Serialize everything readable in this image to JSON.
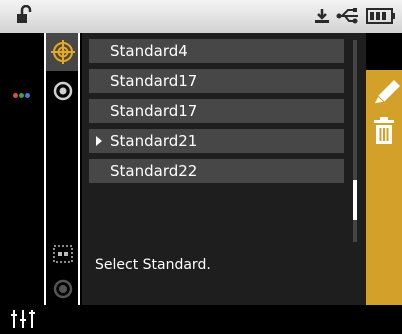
{
  "status_bar": {
    "icons": [
      "lock-open-icon",
      "download-icon",
      "usb-icon",
      "battery-icon"
    ],
    "colors": {
      "bg_top": "#f4f4f4",
      "bg_bottom": "#d2d2d2",
      "icon": "#2a2a2a"
    }
  },
  "left_strip": {
    "icons": [
      "dots-icon",
      "sliders-icon"
    ],
    "dot_colors": [
      "#e34b4b",
      "#3fa04c",
      "#4a78d6"
    ]
  },
  "mode_column": {
    "icons": [
      "target-icon-active",
      "target-icon",
      "dashed-box-icon",
      "circle-icon"
    ],
    "active_color": "#e6a91f"
  },
  "standards_list": {
    "items": [
      {
        "label": "Standard4",
        "selected": false
      },
      {
        "label": "Standard17",
        "selected": false
      },
      {
        "label": "Standard17",
        "selected": false
      },
      {
        "label": "Standard21",
        "selected": true
      },
      {
        "label": "Standard22",
        "selected": false
      }
    ],
    "row_color": "#474747",
    "bg_color": "#1e1e1e"
  },
  "status_message": "Select Standard.",
  "side_toolbar": {
    "icons": [
      "pencil-icon",
      "trash-icon"
    ],
    "accent_color": "#d3a02a"
  }
}
